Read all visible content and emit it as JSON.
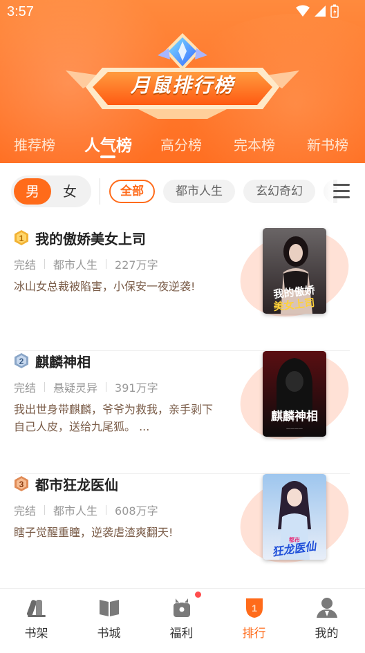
{
  "status_bar": {
    "time": "3:57"
  },
  "banner": {
    "title": "月鼠排行榜"
  },
  "tabs": [
    {
      "label": "推荐榜"
    },
    {
      "label": "人气榜"
    },
    {
      "label": "高分榜"
    },
    {
      "label": "完本榜"
    },
    {
      "label": "新书榜"
    }
  ],
  "gender": {
    "male": "男",
    "female": "女"
  },
  "categories": [
    {
      "label": "全部"
    },
    {
      "label": "都市人生"
    },
    {
      "label": "玄幻奇幻"
    }
  ],
  "books": [
    {
      "rank": "1",
      "title": "我的傲娇美女上司",
      "status": "完结",
      "category": "都市人生",
      "words": "227万字",
      "desc": "冰山女总裁被陷害，小保安一夜逆袭!",
      "cover_text": "我的傲娇美女上司"
    },
    {
      "rank": "2",
      "title": "麒麟神相",
      "status": "完结",
      "category": "悬疑灵异",
      "words": "391万字",
      "desc": "我出世身带麒麟，爷爷为救我，亲手剥下自己人皮，送给九尾狐。 ...",
      "cover_text": "麒麟神相"
    },
    {
      "rank": "3",
      "title": "都市狂龙医仙",
      "status": "完结",
      "category": "都市人生",
      "words": "608万字",
      "desc": "瞎子觉醒重瞳，逆袭虐渣爽翻天!",
      "cover_text": "都市狂龙医仙"
    }
  ],
  "bottom_nav": [
    {
      "label": "书架",
      "icon": "bookshelf-icon"
    },
    {
      "label": "书城",
      "icon": "book-city-icon"
    },
    {
      "label": "福利",
      "icon": "gift-icon"
    },
    {
      "label": "排行",
      "icon": "ranking-trophy-icon"
    },
    {
      "label": "我的",
      "icon": "profile-icon"
    }
  ],
  "colors": {
    "accent": "#ff6b1a",
    "header": "#ff7a2e",
    "gold": "#f2b233",
    "silver": "#8aa6c8",
    "bronze": "#e08a55"
  }
}
